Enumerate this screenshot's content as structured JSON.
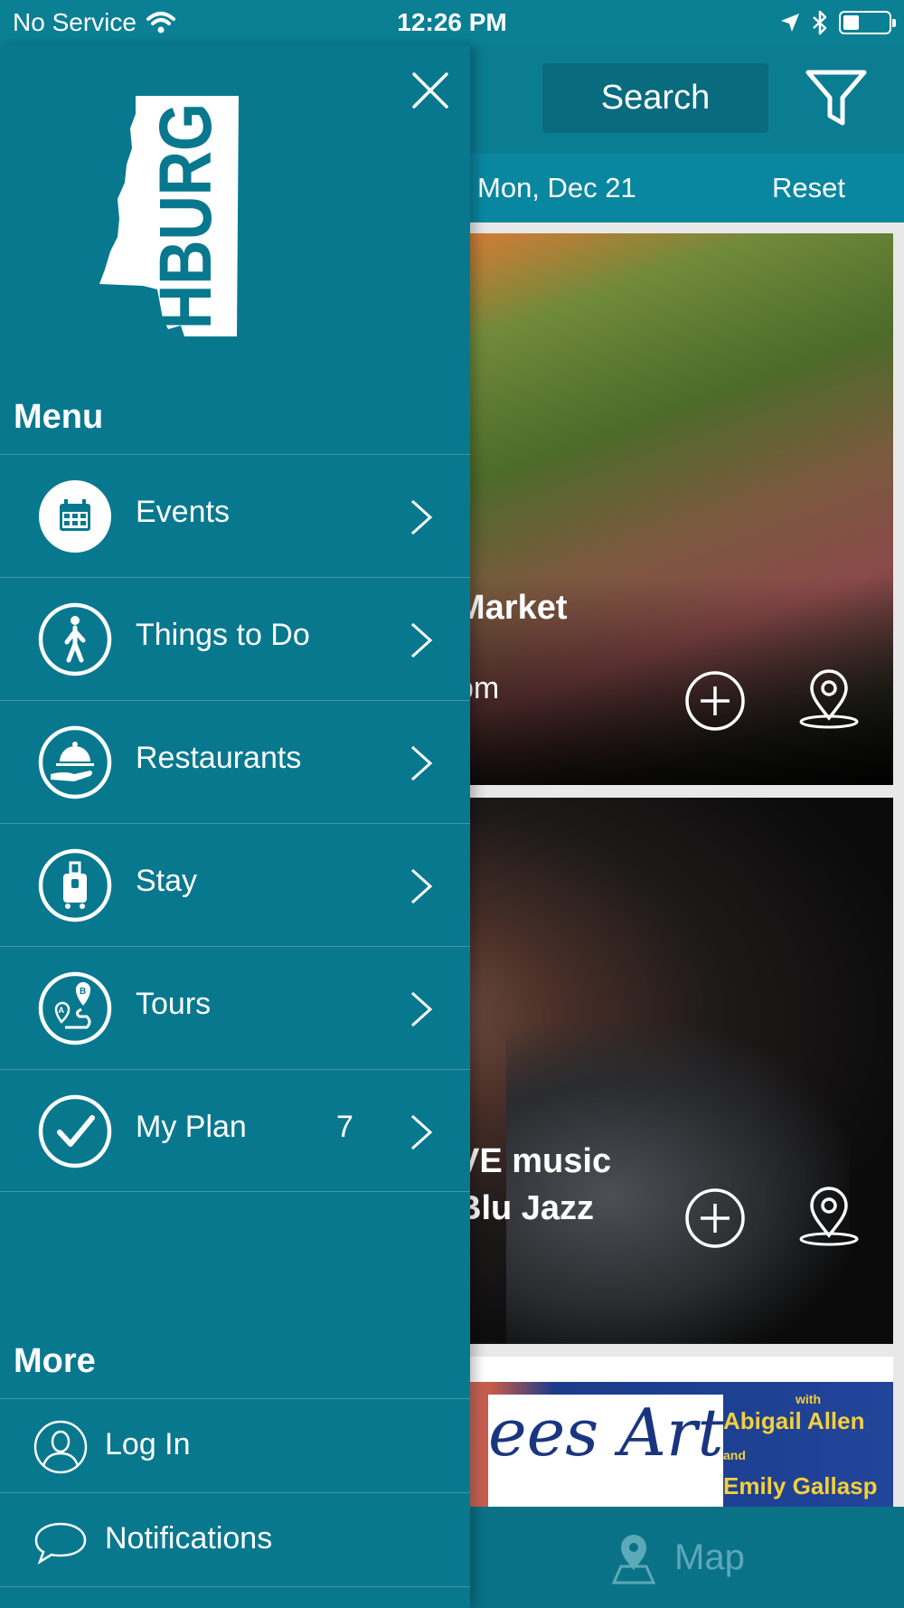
{
  "status_bar": {
    "carrier": "No Service",
    "time": "12:26 PM",
    "battery_level": 0.35
  },
  "top_bar": {
    "search_label": "Search",
    "filter_icon": "filter-icon"
  },
  "date_bar": {
    "date": "Mon, Dec 21",
    "reset_label": "Reset"
  },
  "feed": {
    "cards": [
      {
        "title": "Market",
        "subtitle": "pm",
        "add_icon": "plus-circle-icon",
        "location_icon": "map-pin-icon"
      },
      {
        "title_line1": "VE music",
        "title_line2": "Blu Jazz",
        "add_icon": "plus-circle-icon",
        "location_icon": "map-pin-icon"
      },
      {
        "art_text": "ees Art",
        "art_caption_line1": "Abigail Allen",
        "art_caption_line2": "Emily Gallasp",
        "art_caption_prefix": "with",
        "art_caption_and": "and"
      }
    ]
  },
  "bottom_bar": {
    "map_label": "Map",
    "map_icon": "map-pin-icon"
  },
  "drawer": {
    "close_icon": "close-icon",
    "logo_text": "HBURG",
    "menu_heading": "Menu",
    "menu_items": [
      {
        "label": "Events",
        "icon": "calendar-icon",
        "count": ""
      },
      {
        "label": "Things to Do",
        "icon": "walking-person-icon",
        "count": ""
      },
      {
        "label": "Restaurants",
        "icon": "serving-cloche-icon",
        "count": ""
      },
      {
        "label": "Stay",
        "icon": "suitcase-icon",
        "count": ""
      },
      {
        "label": "Tours",
        "icon": "route-icon",
        "count": ""
      },
      {
        "label": "My Plan",
        "icon": "checkmark-icon",
        "count": "7"
      }
    ],
    "more_heading": "More",
    "more_items": [
      {
        "label": "Log In",
        "icon": "user-icon"
      },
      {
        "label": "Notifications",
        "icon": "chat-bubble-icon"
      }
    ]
  },
  "colors": {
    "drawer_bg": "#08788f",
    "header_bg": "#0a7d92",
    "date_bar_bg": "#0a87a0",
    "bottom_bar_bg": "#0a7287",
    "map_label": "#5ca9b8",
    "text": "#ffffff"
  }
}
